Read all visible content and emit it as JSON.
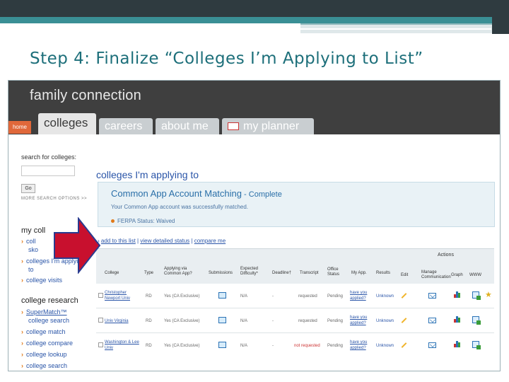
{
  "slide": {
    "title": "Step 4: Finalize “Colleges I’m Applying to List”"
  },
  "app": {
    "brand": "family connection",
    "home_tab": "home",
    "tabs": [
      {
        "label": "colleges",
        "active": true
      },
      {
        "label": "careers",
        "active": false
      },
      {
        "label": "about me",
        "active": false
      },
      {
        "label": "my planner",
        "active": false
      }
    ]
  },
  "sidebar": {
    "search_label": "search for colleges:",
    "go_label": "Go",
    "more_search": "MORE SEARCH OPTIONS >>",
    "my_colleges_heading": "my coll",
    "my_links": [
      {
        "label": "coll"
      },
      {
        "label": "sko"
      },
      {
        "label": "colleges I'm applying"
      },
      {
        "label": "to"
      },
      {
        "label": "college visits"
      }
    ],
    "research_heading": "college research",
    "research_links": [
      {
        "label": "SuperMatch™"
      },
      {
        "label": "college search"
      },
      {
        "label": "college match"
      },
      {
        "label": "college compare"
      },
      {
        "label": "college lookup"
      },
      {
        "label": "college search"
      }
    ]
  },
  "main": {
    "title": "colleges I'm applying to",
    "match": {
      "title": "Common App Account Matching",
      "status": " - Complete",
      "message": "Your Common App account was successfully matched.",
      "ferpa": "FERPA Status: Waived"
    },
    "links": {
      "add": "add to this list",
      "detailed": "view detailed status",
      "compare": "compare me"
    },
    "table": {
      "actions_label": "Actions",
      "headers": [
        "College",
        "Type",
        "Applying via Common App?",
        "Submissions",
        "Expected Difficulty*",
        "Deadline†",
        "Transcript",
        "Office Status",
        "My App.",
        "Results",
        "Edit",
        "Manage Communication",
        "Graph",
        "WWW"
      ],
      "rows": [
        {
          "college": "Christopher Newport Univ",
          "type": "RD",
          "common_app": "Yes (CA Exclusive)",
          "difficulty": "N/A",
          "deadline": "-",
          "transcript": "requested",
          "office_status": "Pending",
          "my_app": "have you applied?",
          "results": "Unknown",
          "star": true
        },
        {
          "college": "Univ Virginia",
          "type": "RD",
          "common_app": "Yes (CA Exclusive)",
          "difficulty": "N/A",
          "deadline": "-",
          "transcript": "requested",
          "office_status": "Pending",
          "my_app": "have you applied?",
          "results": "Unknown",
          "star": false
        },
        {
          "college": "Washington & Lee Univ",
          "type": "RD",
          "common_app": "Yes (CA Exclusive)",
          "difficulty": "N/A",
          "deadline": "-",
          "transcript": "not requested",
          "office_status": "Pending",
          "my_app": "have you applied?",
          "results": "Unknown",
          "star": false
        }
      ]
    }
  },
  "colors": {
    "title": "#1d6f7a",
    "teal_bar": "#3a8f95",
    "dark_bar": "#2f3b40",
    "arrow_fill": "#c8102e",
    "arrow_stroke": "#2a3b8f",
    "link": "#2a55a8"
  }
}
